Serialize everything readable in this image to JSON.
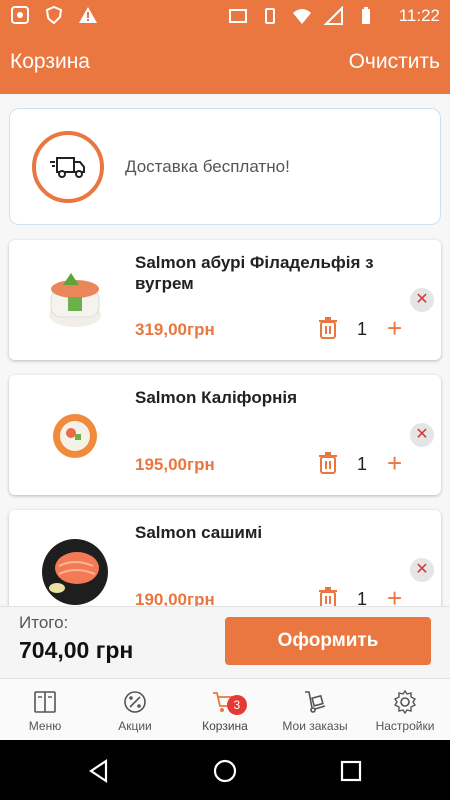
{
  "status_bar": {
    "time": "11:22"
  },
  "app_bar": {
    "title": "Корзина",
    "clear_label": "Очистить"
  },
  "delivery": {
    "text": "Доставка бесплатно!"
  },
  "cart_items": [
    {
      "name": "Salmon абурі Філадельфія з вугрем",
      "price": "319,00грн",
      "quantity": "1"
    },
    {
      "name": "Salmon Каліфорнія",
      "price": "195,00грн",
      "quantity": "1"
    },
    {
      "name": "Salmon сашимі",
      "price": "190,00грн",
      "quantity": "1"
    }
  ],
  "total": {
    "label": "Итого:",
    "value": "704,00 грн",
    "checkout_label": "Оформить"
  },
  "bottom_nav": [
    {
      "label": "Меню",
      "icon": "menu-book-icon"
    },
    {
      "label": "Акции",
      "icon": "percent-badge-icon"
    },
    {
      "label": "Корзина",
      "icon": "cart-icon",
      "badge": "3",
      "active": true
    },
    {
      "label": "Мои заказы",
      "icon": "dolly-icon"
    },
    {
      "label": "Настройки",
      "icon": "gear-icon"
    }
  ],
  "colors": {
    "accent": "#e9773f",
    "badge": "#e53935",
    "remove": "#d03a3a"
  }
}
